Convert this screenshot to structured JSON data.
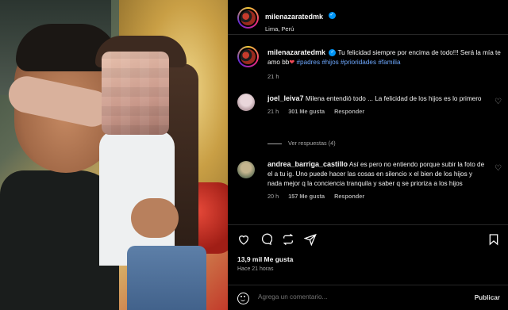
{
  "post": {
    "username": "milenazaratedmk",
    "location": "Lima, Perú",
    "caption_text": "Tu felicidad siempre por encima de todo!!! Será la mía te amo bb",
    "caption_heart": "❤",
    "caption_tags": "#padres #hijos #prioridades #familia",
    "caption_time": "21 h"
  },
  "comments": [
    {
      "username": "joel_leiva7",
      "text": "Milena entendió todo ... La felicidad de los hijos es lo primero",
      "time": "21 h",
      "likes": "301 Me gusta",
      "reply": "Responder",
      "view_replies": "Ver respuestas (4)"
    },
    {
      "username": "andrea_barriga_castillo",
      "text": "Así es pero no entiendo porque subir la foto de el a tu ig. Uno puede hacer las cosas en silencio x el bien de los hijos y nada mejor q la conciencia tranquila y saber q se prioriza a los hijos",
      "time": "20 h",
      "likes": "157 Me gusta",
      "reply": "Responder"
    }
  ],
  "footer": {
    "likes": "13,9 mil Me gusta",
    "time": "Hace 21 horas",
    "comment_placeholder": "Agrega un comentario...",
    "publish": "Publicar"
  },
  "icons": {
    "like": "heart-outline-icon",
    "comment": "comment-bubble-icon",
    "share": "repost-icon",
    "send": "send-icon",
    "save": "bookmark-icon"
  },
  "colors": {
    "background": "#000000",
    "text": "#f5f5f5",
    "muted": "#a8a8a8",
    "verified": "#0095f6",
    "hashtag": "#6ea8fe",
    "heart": "#ed4956"
  }
}
